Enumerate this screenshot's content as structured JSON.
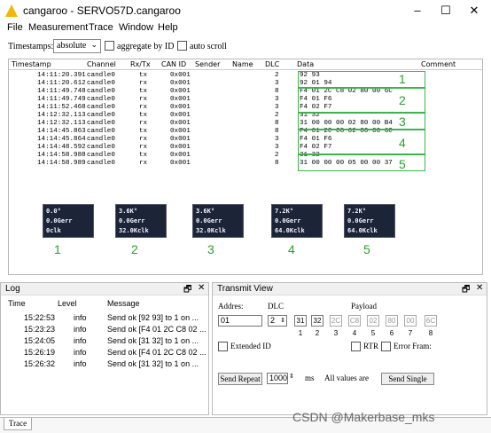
{
  "window": {
    "app_name": "cangaroo",
    "title": "cangaroo - SERVO57D.cangaroo",
    "controls": [
      "–",
      "☐",
      "✕"
    ]
  },
  "menu": [
    "File",
    "Measurement",
    "Trace",
    "Window",
    "Help"
  ],
  "toolbar": {
    "timestamps_label": "Timestamps:",
    "timestamps_value": "absolute",
    "aggregate_label": "aggregate by ID",
    "autoscroll_label": "auto scroll"
  },
  "trace": {
    "columns": [
      "Timestamp",
      "Channel",
      "Rx/Tx",
      "CAN ID",
      "Sender",
      "Name",
      "DLC",
      "Data",
      "Comment"
    ],
    "rows": [
      {
        "ts": "14:11:20.391",
        "ch": "candle0",
        "dir": "tx",
        "id": "0x001",
        "dlc": "2",
        "data": "92 93"
      },
      {
        "ts": "14:11:20.612",
        "ch": "candle0",
        "dir": "rx",
        "id": "0x001",
        "dlc": "3",
        "data": "92 01 94"
      },
      {
        "ts": "14:11:49.748",
        "ch": "candle0",
        "dir": "tx",
        "id": "0x001",
        "dlc": "8",
        "data": "F4 01 2C C8 02 80 00 6C"
      },
      {
        "ts": "14:11:49.749",
        "ch": "candle0",
        "dir": "rx",
        "id": "0x001",
        "dlc": "3",
        "data": "F4 01 F6"
      },
      {
        "ts": "14:11:52.468",
        "ch": "candle0",
        "dir": "rx",
        "id": "0x001",
        "dlc": "3",
        "data": "F4 02 F7"
      },
      {
        "ts": "14:12:32.113",
        "ch": "candle0",
        "dir": "tx",
        "id": "0x001",
        "dlc": "2",
        "data": "31 32"
      },
      {
        "ts": "14:12:32.113",
        "ch": "candle0",
        "dir": "rx",
        "id": "0x001",
        "dlc": "8",
        "data": "31 00 00 00 02 80 00 B4"
      },
      {
        "ts": "14:14:45.863",
        "ch": "candle0",
        "dir": "tx",
        "id": "0x001",
        "dlc": "8",
        "data": "F4 01 2C C8 02 80 00 6C"
      },
      {
        "ts": "14:14:45.864",
        "ch": "candle0",
        "dir": "rx",
        "id": "0x001",
        "dlc": "3",
        "data": "F4 01 F6"
      },
      {
        "ts": "14:14:48.592",
        "ch": "candle0",
        "dir": "rx",
        "id": "0x001",
        "dlc": "3",
        "data": "F4 02 F7"
      },
      {
        "ts": "14:14:58.988",
        "ch": "candle0",
        "dir": "tx",
        "id": "0x001",
        "dlc": "2",
        "data": "31 32"
      },
      {
        "ts": "14:14:58.989",
        "ch": "candle0",
        "dir": "rx",
        "id": "0x001",
        "dlc": "8",
        "data": "31 00 00 00 05 00 00 37"
      }
    ],
    "group_labels": [
      "1",
      "2",
      "3",
      "4",
      "5"
    ]
  },
  "displays": [
    {
      "l1": "0.0°",
      "l2": "0.0Gerr",
      "l3": "0clk",
      "num": "1"
    },
    {
      "l1": "3.6K°",
      "l2": "0.0Gerr",
      "l3": "32.0Kclk",
      "num": "2"
    },
    {
      "l1": "3.6K°",
      "l2": "0.0Gerr",
      "l3": "32.0Kclk",
      "num": "3"
    },
    {
      "l1": "7.2K°",
      "l2": "0.0Gerr",
      "l3": "64.0Kclk",
      "num": "4"
    },
    {
      "l1": "7.2K°",
      "l2": "0.0Gerr",
      "l3": "64.0Kclk",
      "num": "5"
    }
  ],
  "log": {
    "title": "Log",
    "columns": [
      "Time",
      "Level",
      "Message"
    ],
    "rows": [
      {
        "time": "15:22:53",
        "level": "info",
        "msg": "Send ok [92 93] to 1 on ..."
      },
      {
        "time": "15:23:23",
        "level": "info",
        "msg": "Send ok [F4 01 2C C8 02 ..."
      },
      {
        "time": "15:24:05",
        "level": "info",
        "msg": "Send ok [31 32] to 1 on ..."
      },
      {
        "time": "15:26:19",
        "level": "info",
        "msg": "Send ok [F4 01 2C C8 02 ..."
      },
      {
        "time": "15:26:32",
        "level": "info",
        "msg": "Send ok [31 32] to 1 on ..."
      }
    ]
  },
  "transmit": {
    "title": "Transmit View",
    "address_label": "Addres:",
    "dlc_label": "DLC",
    "payload_label": "Payload",
    "address_value": "01",
    "dlc_value": "2",
    "bytes": [
      "31",
      "32",
      "2C",
      "C8",
      "02",
      "80",
      "00",
      "6C"
    ],
    "byte_indices": [
      "1",
      "2",
      "3",
      "4",
      "5",
      "6",
      "7",
      "8"
    ],
    "extended_id_label": "Extended ID",
    "rtr_label": "RTR",
    "error_frame_label": "Error Fram:",
    "send_repeat_label": "Send Repeat",
    "repeat_ms": "1000",
    "ms_label": "ms",
    "all_values_label": "All values are",
    "send_single_label": "Send Single"
  },
  "tabs": {
    "trace": "Trace"
  },
  "panel_controls": {
    "float": "🗗",
    "close": "✕"
  },
  "watermark": "CSDN @Makerbase_mks"
}
